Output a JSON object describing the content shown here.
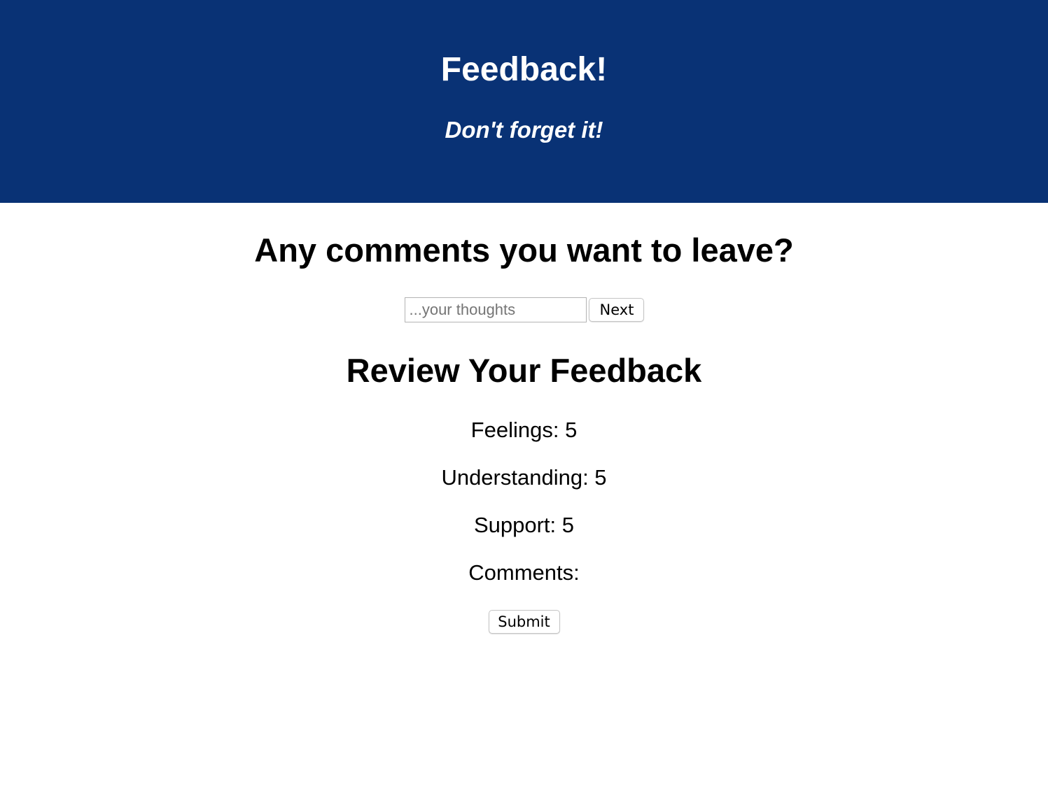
{
  "header": {
    "title": "Feedback!",
    "subtitle": "Don't forget it!",
    "background_color": "#093275"
  },
  "comments_step": {
    "heading": "Any comments you want to leave?",
    "input_placeholder": "...your thoughts",
    "input_value": "",
    "next_label": "Next"
  },
  "review": {
    "heading": "Review Your Feedback",
    "feelings": "Feelings: 5",
    "understanding": "Understanding: 5",
    "support": "Support: 5",
    "comments": "Comments:",
    "submit_label": "Submit"
  }
}
